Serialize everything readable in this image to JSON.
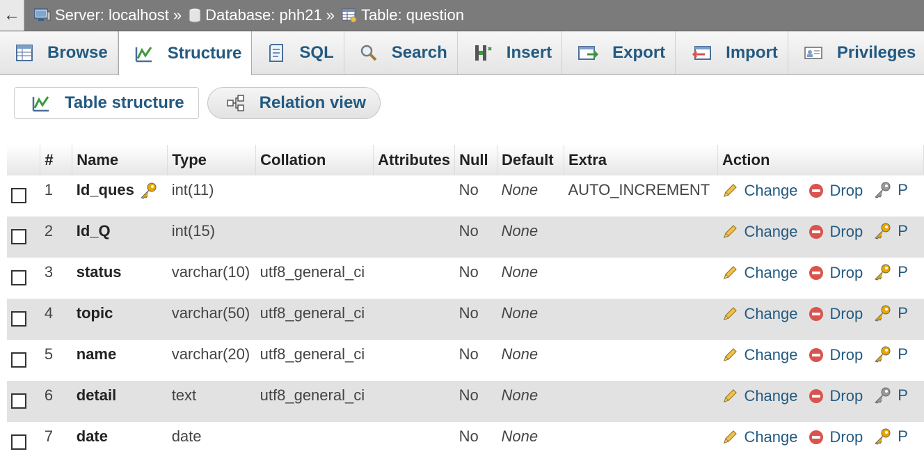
{
  "breadcrumb": {
    "back_glyph": "←",
    "server": "Server: localhost",
    "database": "Database: phh21",
    "table": "Table: question",
    "separator": "»"
  },
  "tabs": [
    {
      "label": "Browse",
      "icon": "browse-icon",
      "active": false
    },
    {
      "label": "Structure",
      "icon": "structure-icon",
      "active": true
    },
    {
      "label": "SQL",
      "icon": "sql-icon",
      "active": false
    },
    {
      "label": "Search",
      "icon": "search-icon",
      "active": false
    },
    {
      "label": "Insert",
      "icon": "insert-icon",
      "active": false
    },
    {
      "label": "Export",
      "icon": "export-icon",
      "active": false
    },
    {
      "label": "Import",
      "icon": "import-icon",
      "active": false
    },
    {
      "label": "Privileges",
      "icon": "privileges-icon",
      "active": false
    }
  ],
  "subtabs": {
    "table_structure": "Table structure",
    "relation_view": "Relation view"
  },
  "table": {
    "headers": [
      "#",
      "Name",
      "Type",
      "Collation",
      "Attributes",
      "Null",
      "Default",
      "Extra",
      "Action"
    ],
    "rows": [
      {
        "num": "1",
        "name": "Id_ques",
        "primary": true,
        "type": "int(11)",
        "collation": "",
        "attributes": "",
        "null": "No",
        "default": "None",
        "extra": "AUTO_INCREMENT"
      },
      {
        "num": "2",
        "name": "Id_Q",
        "primary": false,
        "type": "int(15)",
        "collation": "",
        "attributes": "",
        "null": "No",
        "default": "None",
        "extra": ""
      },
      {
        "num": "3",
        "name": "status",
        "primary": false,
        "type": "varchar(10)",
        "collation": "utf8_general_ci",
        "attributes": "",
        "null": "No",
        "default": "None",
        "extra": ""
      },
      {
        "num": "4",
        "name": "topic",
        "primary": false,
        "type": "varchar(50)",
        "collation": "utf8_general_ci",
        "attributes": "",
        "null": "No",
        "default": "None",
        "extra": ""
      },
      {
        "num": "5",
        "name": "name",
        "primary": false,
        "type": "varchar(20)",
        "collation": "utf8_general_ci",
        "attributes": "",
        "null": "No",
        "default": "None",
        "extra": ""
      },
      {
        "num": "6",
        "name": "detail",
        "primary": false,
        "type": "text",
        "collation": "utf8_general_ci",
        "attributes": "",
        "null": "No",
        "default": "None",
        "extra": ""
      },
      {
        "num": "7",
        "name": "date",
        "primary": false,
        "type": "date",
        "collation": "",
        "attributes": "",
        "null": "No",
        "default": "None",
        "extra": ""
      }
    ],
    "actions": {
      "change": "Change",
      "drop": "Drop",
      "primary_partial": "P"
    }
  },
  "colors": {
    "link": "#235a81",
    "topbar": "#7b7b7b",
    "row_alt": "#e2e2e2",
    "drop_icon": "#d9534f",
    "key_icon": "#e8a800",
    "key_disabled": "#999999"
  }
}
